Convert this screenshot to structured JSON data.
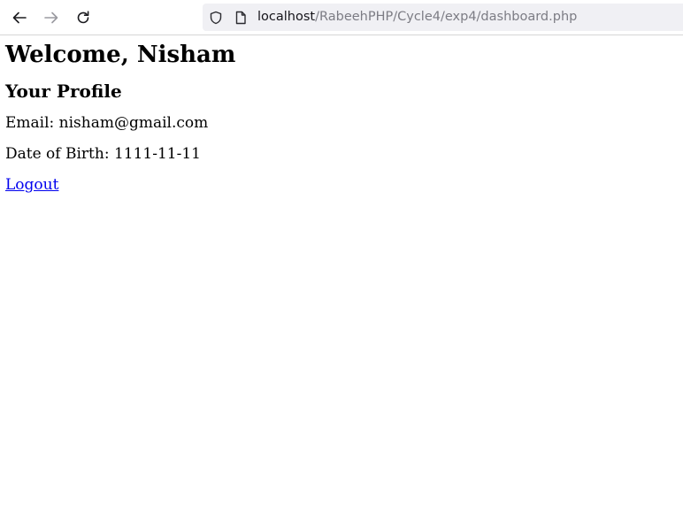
{
  "browser": {
    "url_host": "localhost",
    "url_path": "/RabeehPHP/Cycle4/exp4/dashboard.php"
  },
  "page": {
    "heading": "Welcome, Nisham",
    "subheading": "Your Profile",
    "email_line": "Email: nisham@gmail.com",
    "dob_line": "Date of Birth: 1111-11-11",
    "logout_label": "Logout"
  }
}
